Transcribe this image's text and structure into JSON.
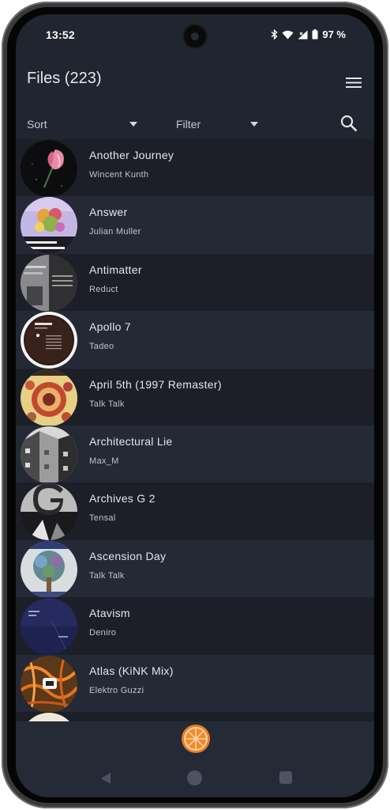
{
  "status_bar": {
    "time": "13:52",
    "battery_text": "97 %",
    "icons": [
      "bluetooth-icon",
      "wifi-icon",
      "signal-icon",
      "battery-icon"
    ]
  },
  "header": {
    "title": "Files (223)",
    "menu_icon": "hamburger-menu-icon"
  },
  "toolbar": {
    "sort_label": "Sort",
    "filter_label": "Filter",
    "search_icon": "search-icon"
  },
  "tracks": [
    {
      "title": "Another Journey",
      "artist": "Wincent Kunth",
      "art": "pink-flower-cover"
    },
    {
      "title": "Answer",
      "artist": "Julian Muller",
      "art": "support-ukraine-cover"
    },
    {
      "title": "Antimatter",
      "artist": "Reduct",
      "art": "grey-building-cover"
    },
    {
      "title": "Apollo 7",
      "artist": "Tadeo",
      "art": "tadeo-dark-cover"
    },
    {
      "title": "April 5th (1997 Remaster)",
      "artist": "Talk Talk",
      "art": "ornate-pattern-cover"
    },
    {
      "title": "Architectural Lie",
      "artist": "Max_M",
      "art": "bw-architecture-cover"
    },
    {
      "title": "Archives G 2",
      "artist": "Tensal",
      "art": "letter-g-cover"
    },
    {
      "title": "Ascension Day",
      "artist": "Talk Talk",
      "art": "tree-illustration-cover"
    },
    {
      "title": "Atavism",
      "artist": "Deniro",
      "art": "dark-blue-cover"
    },
    {
      "title": "Atlas (KiNK Mix)",
      "artist": "Elektro Guzzi",
      "art": "orange-wires-cover"
    }
  ],
  "bottom": {
    "player_icon": "orange-slice-icon"
  },
  "colors": {
    "background": "#21252f",
    "row_alt": "#1c1f28",
    "row_base": "#252936",
    "text_primary": "#e4e6ec",
    "text_secondary": "#c0c3cb",
    "accent_orange": "#f07a2a"
  }
}
